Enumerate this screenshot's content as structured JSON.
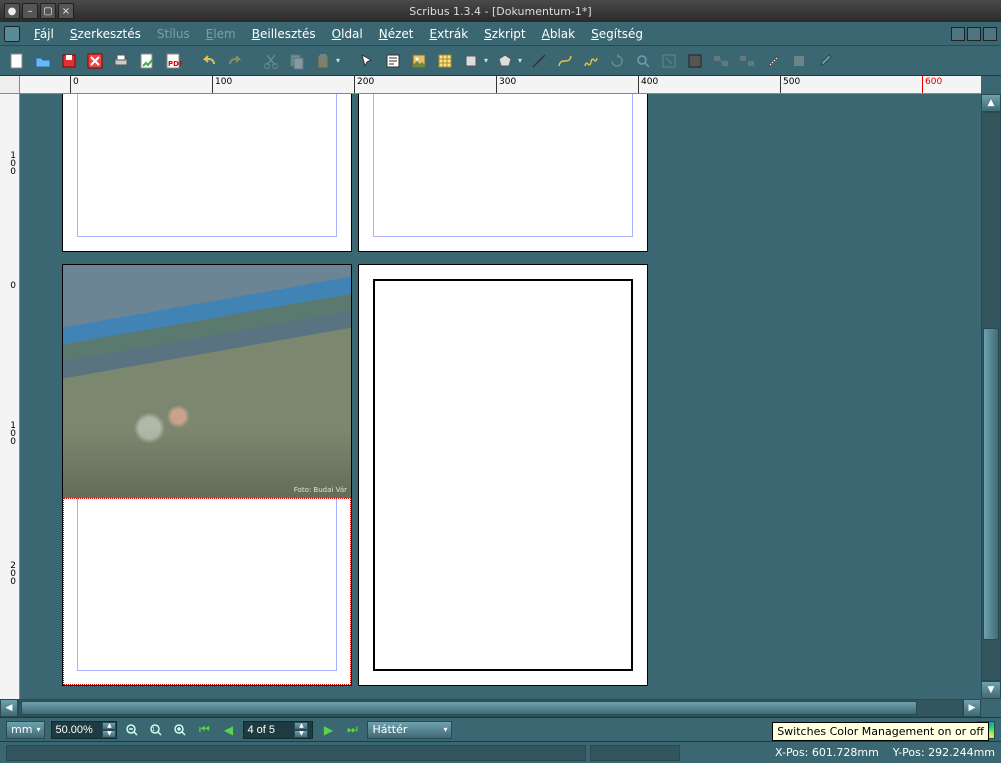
{
  "window": {
    "title": "Scribus 1.3.4 - [Dokumentum-1*]"
  },
  "menu": {
    "items": [
      {
        "label": "Fájl",
        "enabled": true,
        "accel": "F"
      },
      {
        "label": "Szerkesztés",
        "enabled": true,
        "accel": "S"
      },
      {
        "label": "Stílus",
        "enabled": false,
        "accel": ""
      },
      {
        "label": "Elem",
        "enabled": false,
        "accel": "E"
      },
      {
        "label": "Beillesztés",
        "enabled": true,
        "accel": "B"
      },
      {
        "label": "Oldal",
        "enabled": true,
        "accel": "O"
      },
      {
        "label": "Nézet",
        "enabled": true,
        "accel": "N"
      },
      {
        "label": "Extrák",
        "enabled": true,
        "accel": "E"
      },
      {
        "label": "Szkript",
        "enabled": true,
        "accel": "S"
      },
      {
        "label": "Ablak",
        "enabled": true,
        "accel": "A"
      },
      {
        "label": "Segítség",
        "enabled": true,
        "accel": "S"
      }
    ]
  },
  "toolbar": {
    "buttons": [
      "new",
      "open",
      "save",
      "close",
      "print",
      "preflight",
      "pdf",
      "|",
      "undo",
      "redo",
      "|",
      "cut",
      "copy",
      "paste",
      "|",
      "select",
      "text-frame",
      "image-frame",
      "table",
      "shape",
      "polygon",
      "line",
      "|",
      "bezier",
      "freehand",
      "rotate",
      "zoom",
      "edit-contents",
      "edit-text",
      "link-frames",
      "unlink-frames",
      "measure",
      "copy-props",
      "eyedropper"
    ]
  },
  "ruler": {
    "h": [
      "0",
      "100",
      "200",
      "300",
      "400",
      "500",
      "600"
    ],
    "v": [
      "100",
      "0",
      "100",
      "200"
    ]
  },
  "bottom": {
    "unit": "mm",
    "zoom": "50.00%",
    "page": "4 of 5",
    "layer": "Háttér"
  },
  "status": {
    "xpos_label": "X-Pos:",
    "xpos": "601.728mm",
    "ypos_label": "Y-Pos:",
    "ypos": "292.244mm"
  },
  "tooltip": "Switches Color Management on or off"
}
